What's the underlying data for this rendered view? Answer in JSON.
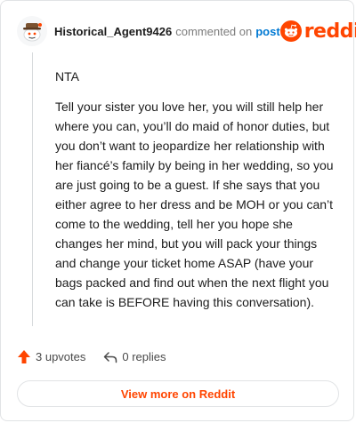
{
  "header": {
    "author": "Historical_Agent9426",
    "action": "commented on",
    "post_link": "post",
    "brand": "reddit"
  },
  "comment": {
    "paragraphs": [
      "NTA",
      "Tell your sister you love her, you will still help her where you can, you’ll do maid of honor duties, but you don’t want to jeopardize her relationship with her fiancé’s family by being in her wedding, so you are just going to be a guest. If she says that you either agree to her dress and be MOH or you can’t come to the wedding, tell her you hope she changes her mind, but you will pack your things and change your ticket home ASAP (have your bags packed and find out when the next flight you can take is BEFORE having this conversation)."
    ]
  },
  "footer": {
    "upvotes": "3 upvotes",
    "replies": "0 replies"
  },
  "cta": {
    "label": "View more on Reddit"
  },
  "colors": {
    "brand": "#ff4500",
    "link": "#0079d3",
    "muted": "#7c7c7c"
  },
  "icons": [
    "snoo-avatar-icon",
    "reddit-logo-icon",
    "upvote-arrow-icon",
    "reply-icon"
  ]
}
